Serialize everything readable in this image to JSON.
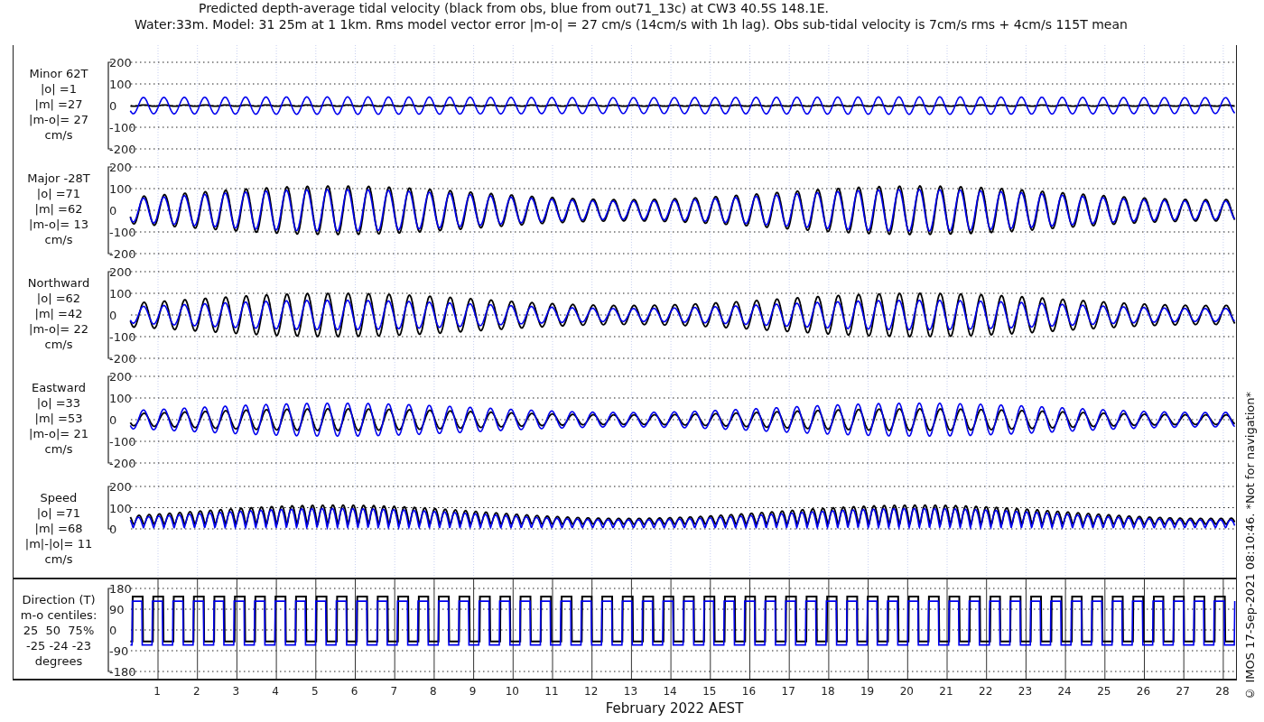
{
  "title": "Predicted depth-average tidal velocity (black from obs, blue from out71_13c) at CW3 40.5S 148.1E.",
  "subtitle": "Water:33m. Model: 31 25m at 1 1km. Rms model vector error |m-o| = 27 cm/s (14cm/s with 1h lag). Obs sub-tidal velocity is 7cm/s rms + 4cm/s 115T mean",
  "panels": [
    {
      "kind": "velocity",
      "label": [
        "Minor 62T",
        "|o| =1",
        "|m| =27",
        "|m-o|= 27",
        "cm/s"
      ],
      "yticks": [
        "200",
        "100",
        "0",
        "-100",
        "-200"
      ]
    },
    {
      "kind": "velocity",
      "label": [
        "Major -28T",
        "|o| =71",
        "|m| =62",
        "|m-o|= 13",
        "cm/s"
      ],
      "yticks": [
        "200",
        "100",
        "0",
        "-100",
        "-200"
      ]
    },
    {
      "kind": "velocity",
      "label": [
        "Northward",
        "|o| =62",
        "|m| =42",
        "|m-o|= 22",
        "cm/s"
      ],
      "yticks": [
        "200",
        "100",
        "0",
        "-100",
        "-200"
      ]
    },
    {
      "kind": "velocity",
      "label": [
        "Eastward",
        "|o| =33",
        "|m| =53",
        "|m-o|= 21",
        "cm/s"
      ],
      "yticks": [
        "200",
        "100",
        "0",
        "-100",
        "-200"
      ]
    },
    {
      "kind": "speed",
      "label": [
        "Speed",
        "|o| =71",
        "|m| =68",
        "|m|-|o|= 11",
        "cm/s"
      ],
      "yticks": [
        "200",
        "100",
        "0"
      ]
    }
  ],
  "direction_panel": {
    "kind": "direction",
    "label": [
      "Direction (T)",
      "m-o centiles:",
      "25  50  75%",
      "-25 -24 -23",
      "degrees"
    ],
    "yticks": [
      "180",
      "90",
      "0",
      "-90",
      "-180"
    ]
  },
  "days": [
    "1",
    "2",
    "3",
    "4",
    "5",
    "6",
    "7",
    "8",
    "9",
    "10",
    "11",
    "12",
    "13",
    "14",
    "15",
    "16",
    "17",
    "18",
    "19",
    "20",
    "21",
    "22",
    "23",
    "24",
    "25",
    "26",
    "27",
    "28"
  ],
  "xlabel": "February 2022 AEST",
  "copyright": "© IMOS 17-Sep-2021 08:10:46. *Not for navigation*"
}
